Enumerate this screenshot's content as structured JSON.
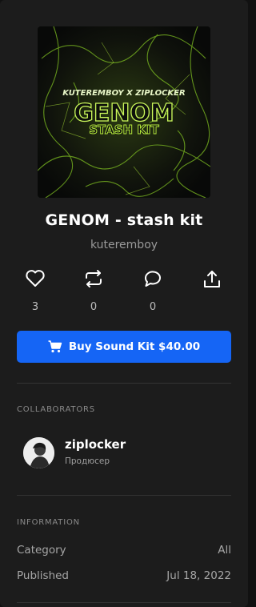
{
  "product": {
    "title": "GENOM - stash kit",
    "artist": "kuteremboy",
    "cover_text_top": "KUTEREMBOY X ZIPLOCKER",
    "cover_text_main": "GENOM",
    "cover_text_sub": "STASH KIT"
  },
  "actions": [
    {
      "icon": "heart-icon",
      "count": "3"
    },
    {
      "icon": "repost-icon",
      "count": "0"
    },
    {
      "icon": "comment-icon",
      "count": "0"
    },
    {
      "icon": "share-icon",
      "count": ""
    }
  ],
  "buy_button": {
    "label": "Buy Sound Kit $40.00",
    "icon": "cart-icon",
    "color": "#1565f5"
  },
  "collaborators": {
    "heading": "COLLABORATORS",
    "items": [
      {
        "name": "ziplocker",
        "role": "Продюсер"
      }
    ]
  },
  "information": {
    "heading": "INFORMATION",
    "rows": [
      {
        "label": "Category",
        "value": "All"
      },
      {
        "label": "Published",
        "value": "Jul 18, 2022"
      }
    ]
  },
  "colors": {
    "accent": "#1565f5",
    "cover_green": "#9be02a",
    "panel": "#1c1c1c"
  }
}
